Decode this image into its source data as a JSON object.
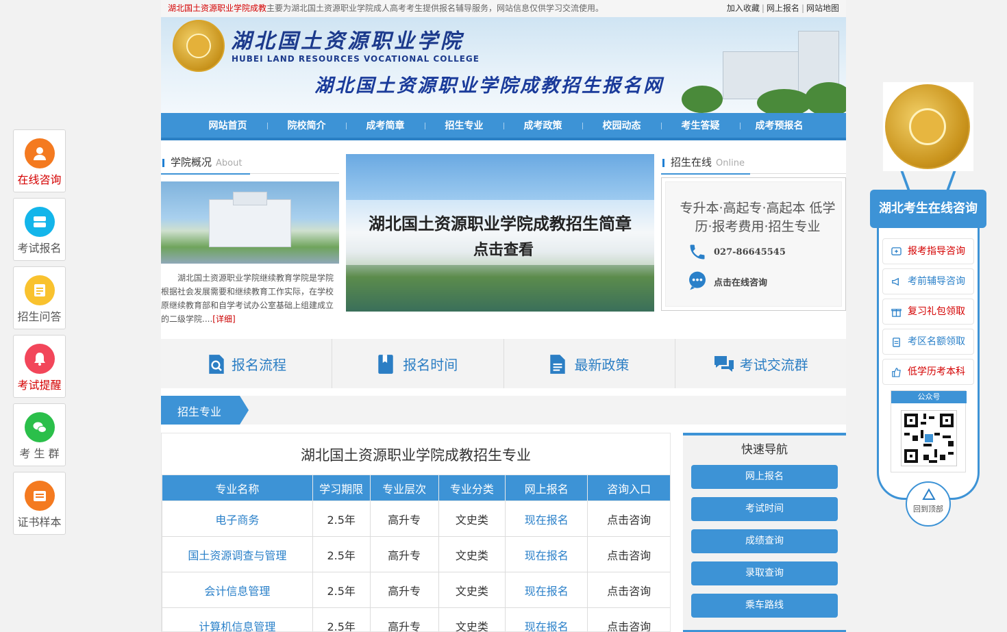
{
  "topbar": {
    "highlight": "湖北国土资源职业学院成教",
    "notice": "主要为湖北国土资源职业学院成人高考考生提供报名辅导服务，网站信息仅供学习交流使用。",
    "links": [
      "加入收藏",
      "网上报名",
      "网站地图"
    ]
  },
  "banner": {
    "school_cn": "湖北国土资源职业学院",
    "school_en": "HUBEI LAND RESOURCES VOCATIONAL COLLEGE",
    "slogan": "湖北国土资源职业学院成教招生报名网"
  },
  "nav": [
    "网站首页",
    "院校简介",
    "成考简章",
    "招生专业",
    "成考政策",
    "校园动态",
    "考生答疑",
    "成考预报名"
  ],
  "about": {
    "title": "学院概况",
    "title_en": "About",
    "text": "湖北国土资源职业学院继续教育学院是学院根据社会发展需要和继续教育工作实际，在学校原继续教育部和自学考试办公室基础上组建成立的二级学院....",
    "more": "[详细]"
  },
  "slide": {
    "line1": "湖北国土资源职业学院成教招生简章",
    "line2": "点击查看"
  },
  "online": {
    "title": "招生在线",
    "title_en": "Online",
    "desc": "专升本·高起专·高起本 低学历·报考费用·招生专业",
    "phone": "027-86645545",
    "consult": "点击在线咨询"
  },
  "quick": [
    {
      "label": "报名流程",
      "icon": "search-doc-icon"
    },
    {
      "label": "报名时间",
      "icon": "book-icon"
    },
    {
      "label": "最新政策",
      "icon": "document-icon"
    },
    {
      "label": "考试交流群",
      "icon": "chat-icon"
    }
  ],
  "majors": {
    "tag": "招生专业",
    "title": "湖北国土资源职业学院成教招生专业",
    "headers": [
      "专业名称",
      "学习期限",
      "专业层次",
      "专业分类",
      "网上报名",
      "咨询入口"
    ],
    "rows": [
      [
        "电子商务",
        "2.5年",
        "高升专",
        "文史类",
        "现在报名",
        "点击咨询"
      ],
      [
        "国土资源调查与管理",
        "2.5年",
        "高升专",
        "文史类",
        "现在报名",
        "点击咨询"
      ],
      [
        "会计信息管理",
        "2.5年",
        "高升专",
        "文史类",
        "现在报名",
        "点击咨询"
      ],
      [
        "计算机信息管理",
        "2.5年",
        "高升专",
        "文史类",
        "现在报名",
        "点击咨询"
      ]
    ]
  },
  "fastnav": {
    "title": "快速导航",
    "items": [
      "网上报名",
      "考试时间",
      "成绩查询",
      "录取查询",
      "乘车路线"
    ]
  },
  "left_float": [
    {
      "label": "在线咨询",
      "color": "#f47a20",
      "label_color": "#d40000",
      "icon": "user-icon"
    },
    {
      "label": "考试报名",
      "color": "#13b5ea",
      "label_color": "#555555",
      "icon": "server-icon"
    },
    {
      "label": "招生问答",
      "color": "#f9c22e",
      "label_color": "#555555",
      "icon": "note-icon"
    },
    {
      "label": "考试提醒",
      "color": "#f2465a",
      "label_color": "#d40000",
      "icon": "bell-icon"
    },
    {
      "label": "考 生 群",
      "color": "#2bbf4a",
      "label_color": "#555555",
      "icon": "wechat-icon"
    },
    {
      "label": "证书样本",
      "color": "#f47a20",
      "label_color": "#555555",
      "icon": "certificate-icon"
    }
  ],
  "right_float": {
    "title": "湖北考生在线咨询",
    "items": [
      {
        "label": "报考指导咨询",
        "icon": "plus-chat-icon"
      },
      {
        "label": "考前辅导咨询",
        "icon": "megaphone-icon"
      },
      {
        "label": "复习礼包领取",
        "icon": "gift-icon"
      },
      {
        "label": "考区名额领取",
        "icon": "clipboard-icon"
      },
      {
        "label": "低学历考本科",
        "icon": "thumbs-up-icon"
      }
    ],
    "qr_title": "公众号",
    "back_top": "回到顶部"
  },
  "colors": {
    "primary": "#3d93d6",
    "accent_red": "#d40000"
  }
}
